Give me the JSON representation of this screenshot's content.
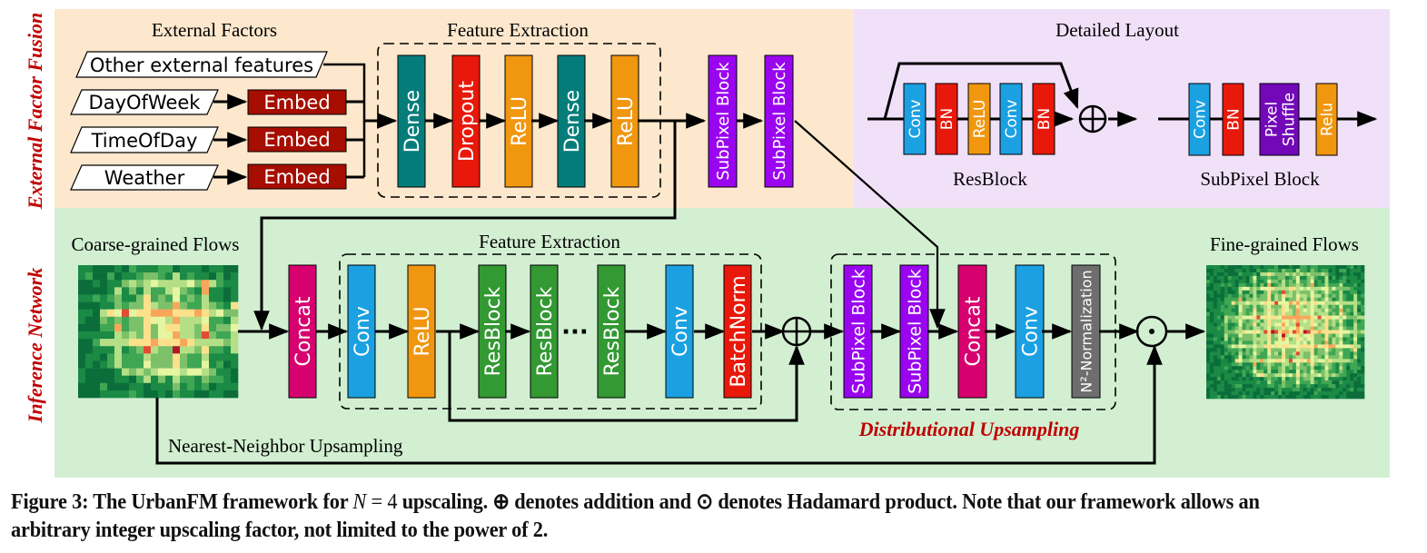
{
  "colors": {
    "top_left_bg": "#fde8cd",
    "top_right_bg": "#f0e0f8",
    "bottom_bg": "#d2efd2",
    "section_label": "#c00000",
    "dense": "#047d7a",
    "dropout": "#e8190a",
    "relu": "#f0960f",
    "subpixel": "#9a05f0",
    "embed": "#a50e00",
    "concat": "#d6006e",
    "conv": "#1ba0e2",
    "resblock": "#339933",
    "batchnorm": "#e8190a",
    "pixelshuffle": "#7208b8",
    "n2norm": "#6e6e6e"
  },
  "section_labels": {
    "top": "External Factor Fusion",
    "bottom": "Inference Network"
  },
  "external": {
    "title": "External Factors",
    "inputs": [
      "Other external features",
      "DayOfWeek",
      "TimeOfDay",
      "Weather"
    ],
    "embed_label": "Embed"
  },
  "top_feature_extraction": {
    "title": "Feature Extraction",
    "layers": [
      "Dense",
      "Dropout",
      "ReLU",
      "Dense",
      "ReLU"
    ]
  },
  "top_subpixel": [
    "SubPixel Block",
    "SubPixel Block"
  ],
  "detailed_layout": {
    "title": "Detailed Layout",
    "resblock": {
      "title": "ResBlock",
      "layers": [
        "Conv",
        "BN",
        "ReLU",
        "Conv",
        "BN"
      ]
    },
    "subpixel": {
      "title": "SubPixel Block",
      "layers": [
        "Conv",
        "BN",
        "Pixel Shuffle",
        "Relu"
      ]
    }
  },
  "inference": {
    "coarse_title": "Coarse-grained Flows",
    "fine_title": "Fine-grained Flows",
    "concat_label": "Concat",
    "feature_extraction": {
      "title": "Feature Extraction",
      "layers": [
        "Conv",
        "ReLU",
        "ResBlock",
        "ResBlock",
        "ResBlock",
        "Conv",
        "BatchNorm"
      ],
      "ellipsis": "···"
    },
    "distributional": {
      "title": "Distributional Upsampling",
      "layers": [
        "SubPixel Block",
        "SubPixel Block",
        "Concat",
        "Conv",
        "N²-Normalization"
      ]
    },
    "nn_upsampling_label": "Nearest-Neighbor Upsampling",
    "add_symbol": "⊕",
    "hadamard_symbol": "⊙"
  },
  "caption": {
    "prefix": "Figure 3: The UrbanFM framework for ",
    "math": "N",
    "eq": " = 4",
    "rest": " upscaling. ⊕ denotes addition and ⊙ denotes Hadamard product. Note that our framework allows an arbitrary integer upscaling factor, not limited to the power of 2."
  }
}
